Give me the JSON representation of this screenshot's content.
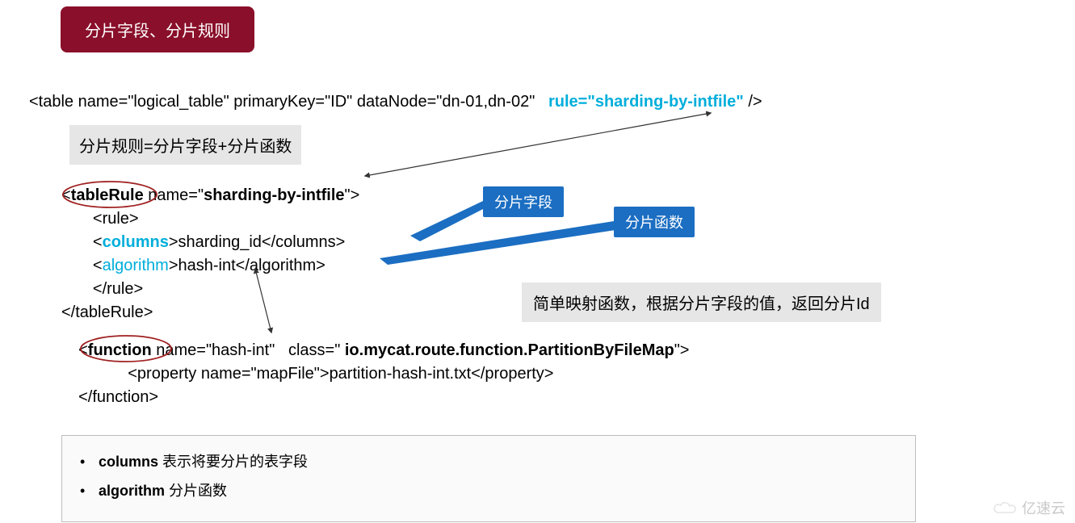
{
  "title": "分片字段、分片规则",
  "table_line": {
    "prefix": "<table name=\"logical_table\" primaryKey=\"ID\" dataNode=\"dn-01,dn-02\"   ",
    "rule_attr": "rule=\"sharding-by-intfile\"",
    "suffix": " />"
  },
  "formula": "分片规则=分片字段+分片函数",
  "code1": {
    "l1a": "<",
    "l1b": "tableRule",
    "l1c": " name=\"",
    "l1d": "sharding-by-intfile",
    "l1e": "\">",
    "l2": "       <rule>",
    "l3a": "       <",
    "l3b": "columns",
    "l3c": ">sharding_id</columns>",
    "l4a": "       <",
    "l4b": "algorithm",
    "l4c": ">hash-int</algorithm>",
    "l5": "       </rule>",
    "l6": "</tableRule>"
  },
  "code2": {
    "l1a": "  <",
    "l1b": "function",
    "l1c": " name=\"hash-int\"   class=\" ",
    "l1d": "io.mycat.route.function.PartitionByFileMap",
    "l1e": "\">",
    "l2": "             <property name=\"mapFile\">partition-hash-int.txt</property>",
    "l3": "  </function>"
  },
  "callouts": {
    "field": "分片字段",
    "func": "分片函数"
  },
  "grey_note": "简单映射函数，根据分片字段的值，返回分片Id",
  "bullets": {
    "b1_key": "columns",
    "b1_text": " 表示将要分片的表字段",
    "b2_key": "algorithm",
    "b2_text": " 分片函数"
  },
  "watermark": "亿速云"
}
